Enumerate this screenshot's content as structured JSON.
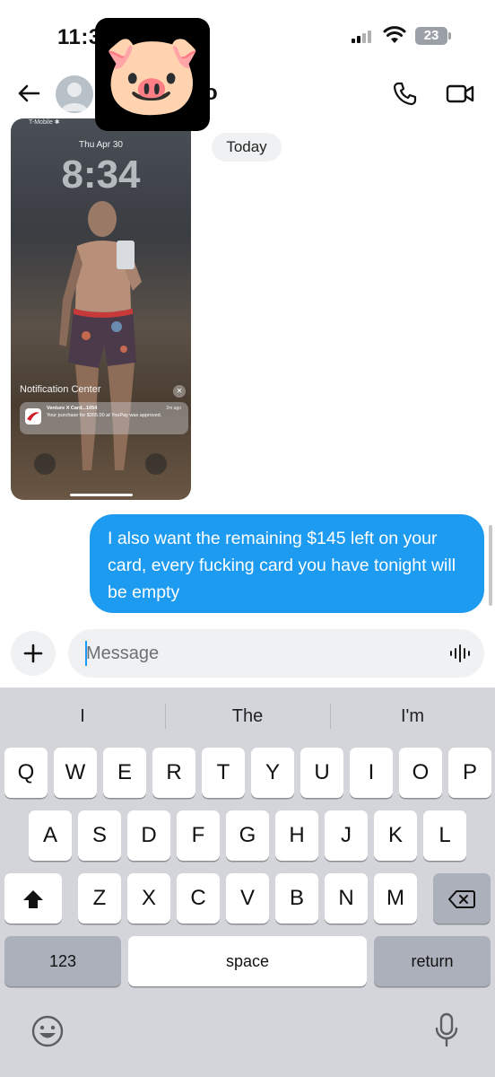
{
  "status_bar": {
    "time": "11:3",
    "battery": "23"
  },
  "header": {
    "title_fragment": "o"
  },
  "censor": {
    "emoji": "🐷"
  },
  "photo": {
    "carrier": "T-Mobile ✱",
    "date": "Thu Apr 30",
    "time": "8:34",
    "notification_center": "Notification Center",
    "notification": {
      "title": "Venture X Card...1054",
      "ago": "2m ago",
      "body": "Your purchase for $355.00 at YouPay was approved."
    }
  },
  "chat": {
    "date_label": "Today",
    "message": "I also want the remaining $145 left on your card, every fucking card you have tonight will be empty"
  },
  "composer": {
    "placeholder": "Message"
  },
  "keyboard": {
    "suggestions": [
      "I",
      "The",
      "I'm"
    ],
    "row1": [
      "Q",
      "W",
      "E",
      "R",
      "T",
      "Y",
      "U",
      "I",
      "O",
      "P"
    ],
    "row2": [
      "A",
      "S",
      "D",
      "F",
      "G",
      "H",
      "J",
      "K",
      "L"
    ],
    "row3": [
      "Z",
      "X",
      "C",
      "V",
      "B",
      "N",
      "M"
    ],
    "numbers_label": "123",
    "space_label": "space",
    "return_label": "return"
  },
  "icons": {
    "back": "arrow-left-icon",
    "call": "phone-icon",
    "video": "video-camera-icon",
    "add": "plus-icon",
    "voice": "waveform-icon",
    "shift": "shift-arrow-icon",
    "delete": "backspace-icon",
    "emoji": "smiley-icon",
    "dictation": "microphone-icon"
  },
  "colors": {
    "accent": "#1d9bf0",
    "keyboard_bg": "#d3d5db",
    "input_bg": "#eff1f3"
  }
}
